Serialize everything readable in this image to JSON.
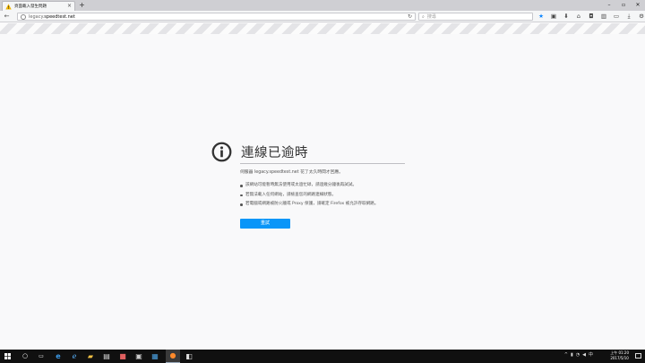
{
  "browser": {
    "tab_title": "頁面載入發生問題",
    "tab_close": "×",
    "new_tab": "+",
    "window_controls": [
      "–",
      "▫",
      "✕"
    ],
    "url_host": "legacy.speedtest.net",
    "url_prefix": "legacy.",
    "url_domain": "speedtest.net",
    "search_placeholder": "搜尋",
    "accent_color": "#0a84ff"
  },
  "toolbar_icons": [
    "star-icon",
    "clipboard-icon",
    "download-icon",
    "home-icon",
    "pocket-icon",
    "bookmarks-icon",
    "synced-tabs-icon",
    "library-icon",
    "settings-icon",
    "menu-icon"
  ],
  "error": {
    "title": "連線已逾時",
    "description": "伺服器 legacy.speedtest.net 花了太久時間才回應。",
    "items": [
      "該網站可能暫時無法使用或太過忙碌，請過幾分鐘後再試試。",
      "若無法載入任何網站，請檢查您的網路連線狀態。",
      "若電腦或網路被防火牆或 Proxy 保護，請確定 Firefox 被允許存取網路。"
    ],
    "retry_label": "重試",
    "button_color": "#0996f8"
  },
  "taskbar": {
    "time": "上午 01:20",
    "date": "2017/5/10"
  }
}
